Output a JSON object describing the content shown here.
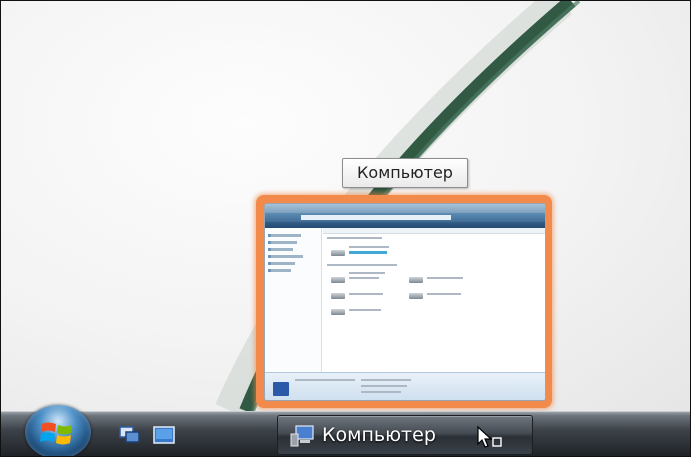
{
  "tooltip": {
    "text": "Компьютер"
  },
  "thumbnail": {
    "window_title": "Компьютер"
  },
  "taskbar": {
    "start_button": "start-orb",
    "quick_launch": [
      "switch-windows-icon",
      "show-desktop-icon"
    ],
    "task_button_label": "Компьютер"
  },
  "colors": {
    "highlight": "#f28a4b",
    "taskbar_dark": "#1e2227",
    "swoosh": "#1e4a32"
  }
}
